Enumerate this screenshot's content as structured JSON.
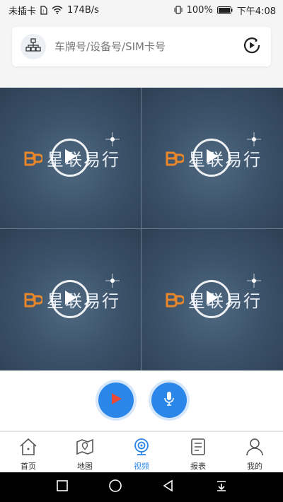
{
  "status_bar": {
    "carrier": "未插卡",
    "speed": "174B/s",
    "battery": "100%",
    "time": "下午4:08"
  },
  "search": {
    "placeholder": "车牌号/设备号/SIM卡号",
    "value": ""
  },
  "video_cells": [
    {
      "brand_text": "星联易行"
    },
    {
      "brand_text": "星联易行"
    },
    {
      "brand_text": "星联易行"
    },
    {
      "brand_text": "星联易行"
    }
  ],
  "tabs": [
    {
      "label": "首页",
      "icon": "home-icon"
    },
    {
      "label": "地图",
      "icon": "map-icon"
    },
    {
      "label": "视频",
      "icon": "camera-icon",
      "active": true
    },
    {
      "label": "报表",
      "icon": "report-icon"
    },
    {
      "label": "我的",
      "icon": "user-icon"
    }
  ],
  "colors": {
    "accent": "#2a86e8",
    "brand_orange": "#e8862a",
    "video_bg": "#3c536b"
  }
}
